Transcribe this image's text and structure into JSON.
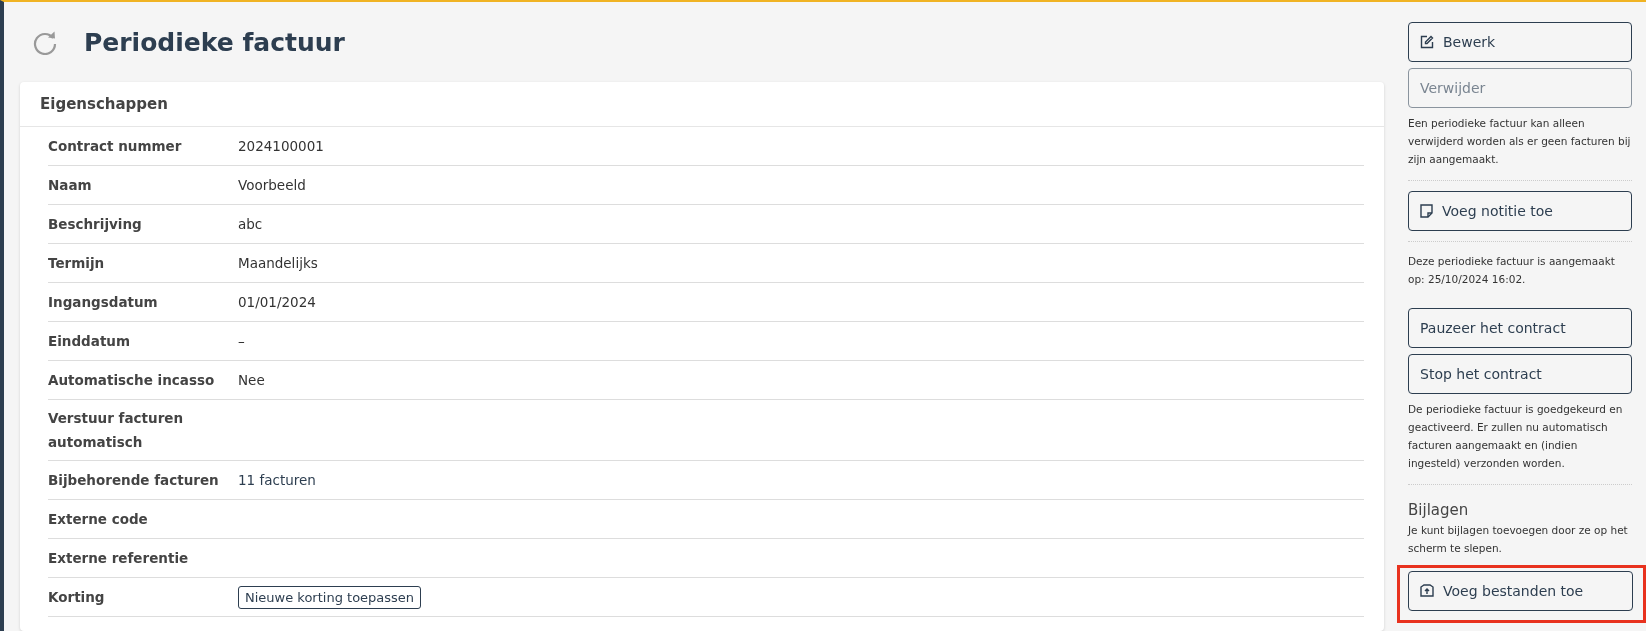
{
  "header": {
    "title": "Periodieke factuur"
  },
  "properties": {
    "title": "Eigenschappen",
    "rows": [
      {
        "label": "Contract nummer",
        "kind": "text",
        "value": "2024100001"
      },
      {
        "label": "Naam",
        "kind": "text",
        "value": "Voorbeeld"
      },
      {
        "label": "Beschrijving",
        "kind": "text",
        "value": "abc"
      },
      {
        "label": "Termijn",
        "kind": "text",
        "value": "Maandelijks"
      },
      {
        "label": "Ingangsdatum",
        "kind": "text",
        "value": "01/01/2024"
      },
      {
        "label": "Einddatum",
        "kind": "text",
        "value": "–"
      },
      {
        "label": "Automatische incasso",
        "kind": "text",
        "value": "Nee"
      },
      {
        "label": "Verstuur facturen automatisch",
        "kind": "empty"
      },
      {
        "label": "Bijbehorende facturen",
        "kind": "link",
        "value": "11 facturen"
      },
      {
        "label": "Externe code",
        "kind": "empty"
      },
      {
        "label": "Externe referentie",
        "kind": "empty"
      },
      {
        "label": "Korting",
        "kind": "button",
        "value": "Nieuwe korting toepassen"
      }
    ]
  },
  "sidebar": [
    {
      "kind": "edit",
      "label": "Bewerk",
      "disabled": false,
      "highlighted": false
    },
    {
      "kind": "button",
      "label": "Verwijder",
      "disabled": true,
      "highlighted": false
    },
    {
      "kind": "note",
      "text": "Een periodieke factuur kan alleen verwijderd worden als er geen facturen bij zijn aangemaakt."
    },
    {
      "kind": "divider"
    },
    {
      "kind": "notebutton",
      "label": "Voeg notitie toe",
      "disabled": false,
      "highlighted": false
    },
    {
      "kind": "divider"
    },
    {
      "kind": "note",
      "text": "Deze periodieke factuur is aangemaakt op: 25/10/2024 16:02."
    },
    {
      "kind": "spacer"
    },
    {
      "kind": "button",
      "label": "Pauzeer het contract",
      "disabled": false,
      "highlighted": false
    },
    {
      "kind": "button",
      "label": "Stop het contract",
      "disabled": false,
      "highlighted": false
    },
    {
      "kind": "note",
      "text": "De periodieke factuur is goedgekeurd en geactiveerd. Er zullen nu automatisch facturen aangemaakt en (indien ingesteld) verzonden worden."
    },
    {
      "kind": "divider"
    },
    {
      "kind": "heading",
      "text": "Bijlagen"
    },
    {
      "kind": "note",
      "text": "Je kunt bijlagen toevoegen door ze op het scherm te slepen."
    },
    {
      "kind": "upload",
      "label": "Voeg bestanden toe",
      "disabled": false,
      "highlighted": true
    }
  ]
}
